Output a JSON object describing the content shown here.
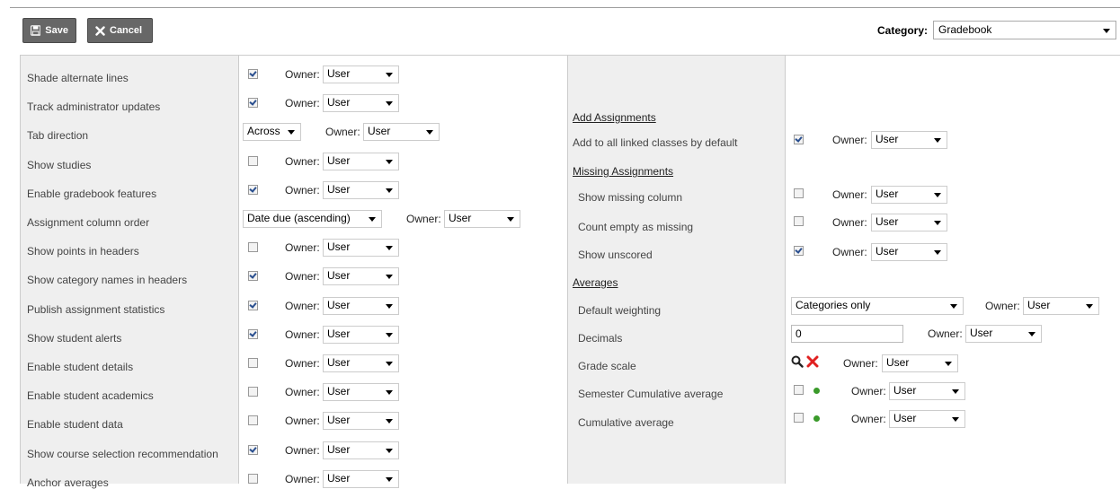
{
  "toolbar": {
    "save_label": "Save",
    "cancel_label": "Cancel"
  },
  "category": {
    "label": "Category:",
    "value": "Gradebook"
  },
  "owner_label": "Owner:",
  "left_settings": [
    {
      "label": "Shade alternate lines",
      "control": "checkbox",
      "checked": true,
      "owner": "User"
    },
    {
      "label": "Track administrator updates",
      "control": "checkbox",
      "checked": true,
      "owner": "User"
    },
    {
      "label": "Tab direction",
      "control": "select",
      "value": "Across",
      "owner": "User"
    },
    {
      "label": "Show studies",
      "control": "checkbox",
      "checked": false,
      "owner": "User"
    },
    {
      "label": "Enable gradebook features",
      "control": "checkbox",
      "checked": true,
      "owner": "User"
    },
    {
      "label": "Assignment column order",
      "control": "select",
      "value": "Date due (ascending)",
      "owner": "User"
    },
    {
      "label": "Show points in headers",
      "control": "checkbox",
      "checked": false,
      "owner": "User"
    },
    {
      "label": "Show category names in headers",
      "control": "checkbox",
      "checked": true,
      "owner": "User"
    },
    {
      "label": "Publish assignment statistics",
      "control": "checkbox",
      "checked": true,
      "owner": "User"
    },
    {
      "label": "Show student alerts",
      "control": "checkbox",
      "checked": true,
      "owner": "User"
    },
    {
      "label": "Enable student details",
      "control": "checkbox",
      "checked": false,
      "owner": "User"
    },
    {
      "label": "Enable student academics",
      "control": "checkbox",
      "checked": false,
      "owner": "User"
    },
    {
      "label": "Enable student data",
      "control": "checkbox",
      "checked": false,
      "owner": "User"
    },
    {
      "label": "Show course selection recommendation",
      "control": "checkbox",
      "checked": true,
      "owner": "User"
    },
    {
      "label": "Anchor averages",
      "control": "checkbox",
      "checked": false,
      "owner": "User"
    }
  ],
  "right": {
    "add_assignments": {
      "heading": "Add Assignments",
      "items": [
        {
          "label": "Add to all linked classes by default",
          "checked": true,
          "owner": "User"
        }
      ]
    },
    "missing_assignments": {
      "heading": "Missing Assignments",
      "items": [
        {
          "label": "Show missing column",
          "checked": false,
          "owner": "User"
        },
        {
          "label": "Count empty as missing",
          "checked": false,
          "owner": "User"
        },
        {
          "label": "Show unscored",
          "checked": true,
          "owner": "User"
        }
      ]
    },
    "averages": {
      "heading": "Averages",
      "default_weighting": {
        "label": "Default weighting",
        "value": "Categories only",
        "owner": "User"
      },
      "decimals": {
        "label": "Decimals",
        "value": "0",
        "owner": "User"
      },
      "grade_scale": {
        "label": "Grade scale",
        "owner": "User"
      },
      "semester_cumulative": {
        "label": "Semester Cumulative average",
        "checked": false,
        "owner": "User"
      },
      "cumulative": {
        "label": "Cumulative average",
        "checked": false,
        "owner": "User"
      }
    }
  }
}
